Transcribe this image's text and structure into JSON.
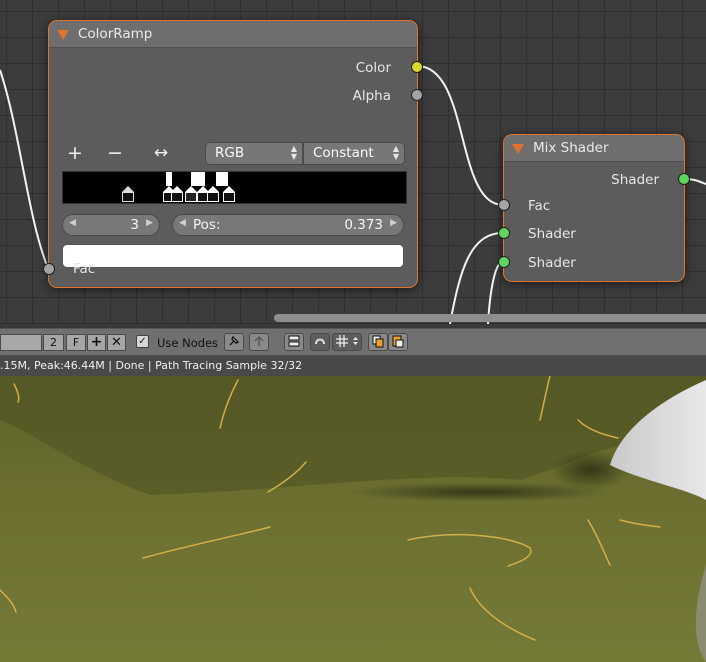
{
  "colorramp_node": {
    "title": "ColorRamp",
    "outputs": {
      "color": "Color",
      "alpha": "Alpha"
    },
    "tools": {
      "add": "+",
      "remove": "−",
      "flip": "↔"
    },
    "color_mode": "RGB",
    "interpolation": "Constant",
    "active_stop_index": "3",
    "pos_label": "Pos:",
    "pos_value": "0.373",
    "input": "Fac",
    "swatch_color": "#ffffff"
  },
  "mix_shader_node": {
    "title": "Mix Shader",
    "output": "Shader",
    "inputs": {
      "fac": "Fac",
      "shader1": "Shader",
      "shader2": "Shader"
    }
  },
  "header": {
    "users_count": "2",
    "fake_user": "F",
    "use_nodes_label": "Use Nodes",
    "use_nodes_checked": true
  },
  "status": {
    "text": ".15M, Peak:46.44M | Done | Path Tracing Sample 32/32"
  },
  "colors": {
    "node_border": "#e0732c",
    "socket_color": "#d7d72e",
    "socket_shader": "#5fd45f",
    "socket_float": "#a4a4a4",
    "render_ground": "#6e7131"
  },
  "icons": [
    "collapse-arrow-icon",
    "add-icon",
    "remove-icon",
    "flip-icon",
    "pin-icon",
    "parent-icon",
    "snap-icon",
    "backdrop-icon",
    "copy-icon",
    "paste-icon",
    "delete-icon",
    "new-icon"
  ]
}
